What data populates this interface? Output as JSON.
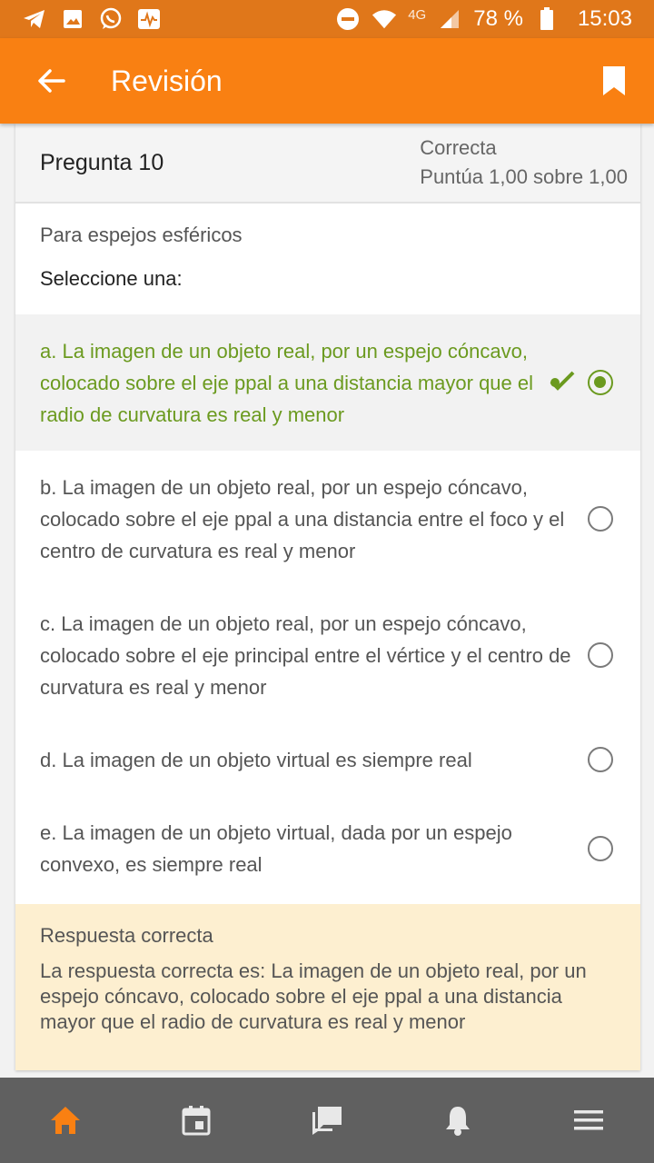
{
  "status_bar": {
    "network": "4G",
    "battery": "78 %",
    "time": "15:03",
    "icons": [
      "telegram-icon",
      "image-icon",
      "whatsapp-icon",
      "activity-icon",
      "dnd-icon",
      "wifi-icon",
      "signal-icon",
      "battery-icon"
    ]
  },
  "appbar": {
    "title": "Revisión",
    "icons": [
      "arrow-back-icon",
      "bookmark-icon"
    ]
  },
  "question": {
    "number": "Pregunta 10",
    "state": "Correcta",
    "score": "Puntúa 1,00 sobre 1,00",
    "prompt": "Para espejos esféricos",
    "instruction": "Seleccione una:",
    "options": [
      {
        "text": "a. La imagen de un objeto real, por un espejo cóncavo, colocado sobre el eje ppal a una distancia mayor que el radio de curvatura es real y menor",
        "selected": true,
        "correct": true
      },
      {
        "text": "b. La imagen de un objeto real, por un espejo cóncavo, colocado sobre el eje ppal a una distancia entre el foco y el centro de curvatura es real y menor",
        "selected": false
      },
      {
        "text": "c. La imagen de un objeto real, por un espejo cóncavo, colocado sobre el eje principal entre el vértice y el centro de curvatura es real y menor",
        "selected": false
      },
      {
        "text": "d. La imagen de un objeto virtual es siempre real",
        "selected": false
      },
      {
        "text": "e. La imagen de un objeto virtual, dada por un espejo convexo, es siempre real",
        "selected": false
      }
    ]
  },
  "feedback": {
    "heading": "Respuesta correcta",
    "body": "La respuesta correcta es: La imagen de un objeto real, por un espejo cóncavo, colocado sobre el eje ppal a una distancia mayor que el radio de curvatura es real y menor"
  },
  "bottom_nav": {
    "items": [
      "home-icon",
      "calendar-icon",
      "messages-icon",
      "notifications-icon",
      "menu-icon"
    ],
    "active_color": "#f98012",
    "inactive_color": "#e8e8e8"
  },
  "colors": {
    "status_bar": "#e0771a",
    "appbar": "#f98012",
    "correct": "#6b9a1f",
    "feedback_bg": "#fdefd0"
  }
}
